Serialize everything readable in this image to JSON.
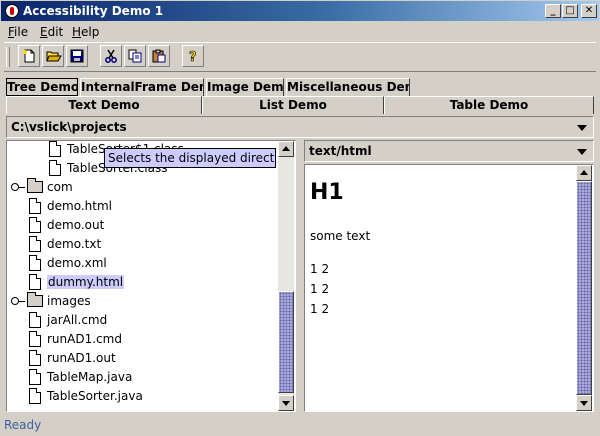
{
  "window": {
    "title": "Accessibility Demo 1",
    "minimize": "_",
    "maximize": "□",
    "close": "✕"
  },
  "menu": [
    {
      "label": "File",
      "mnemonic": "F",
      "rest": "ile"
    },
    {
      "label": "Edit",
      "mnemonic": "E",
      "rest": "dit"
    },
    {
      "label": "Help",
      "mnemonic": "H",
      "rest": "elp"
    }
  ],
  "toolbar": {
    "icons": [
      "new-file-icon",
      "open-folder-icon",
      "save-icon",
      "cut-icon",
      "copy-icon",
      "paste-icon",
      "help-icon"
    ]
  },
  "tabs": {
    "row1": [
      "Tree Demo",
      "InternalFrame Demo",
      "Image Demo",
      "Miscellaneous Demo"
    ],
    "row2": [
      "Text Demo",
      "List Demo",
      "Table Demo"
    ],
    "selected": "Tree Demo"
  },
  "directory": {
    "path": "C:\\vslick\\projects"
  },
  "tree": {
    "items": [
      {
        "label": "TableSorter$1.class",
        "type": "file"
      },
      {
        "label": "TableSorter.class",
        "type": "file"
      },
      {
        "label": "com",
        "type": "folder"
      },
      {
        "label": "demo.html",
        "type": "file"
      },
      {
        "label": "demo.out",
        "type": "file"
      },
      {
        "label": "demo.txt",
        "type": "file"
      },
      {
        "label": "demo.xml",
        "type": "file"
      },
      {
        "label": "dummy.html",
        "type": "file",
        "selected": true
      },
      {
        "label": "images",
        "type": "folder"
      },
      {
        "label": "jarAll.cmd",
        "type": "file"
      },
      {
        "label": "runAD1.cmd",
        "type": "file"
      },
      {
        "label": "runAD1.out",
        "type": "file"
      },
      {
        "label": "TableMap.java",
        "type": "file"
      },
      {
        "label": "TableSorter.java",
        "type": "file"
      }
    ]
  },
  "tooltip": "Selects the displayed directory",
  "content_type": {
    "value": "text/html"
  },
  "content": {
    "heading": "H1",
    "paragraph": "some text",
    "lines": [
      "1  2",
      "1  2",
      "1  2"
    ]
  },
  "status": {
    "text": "Ready"
  }
}
